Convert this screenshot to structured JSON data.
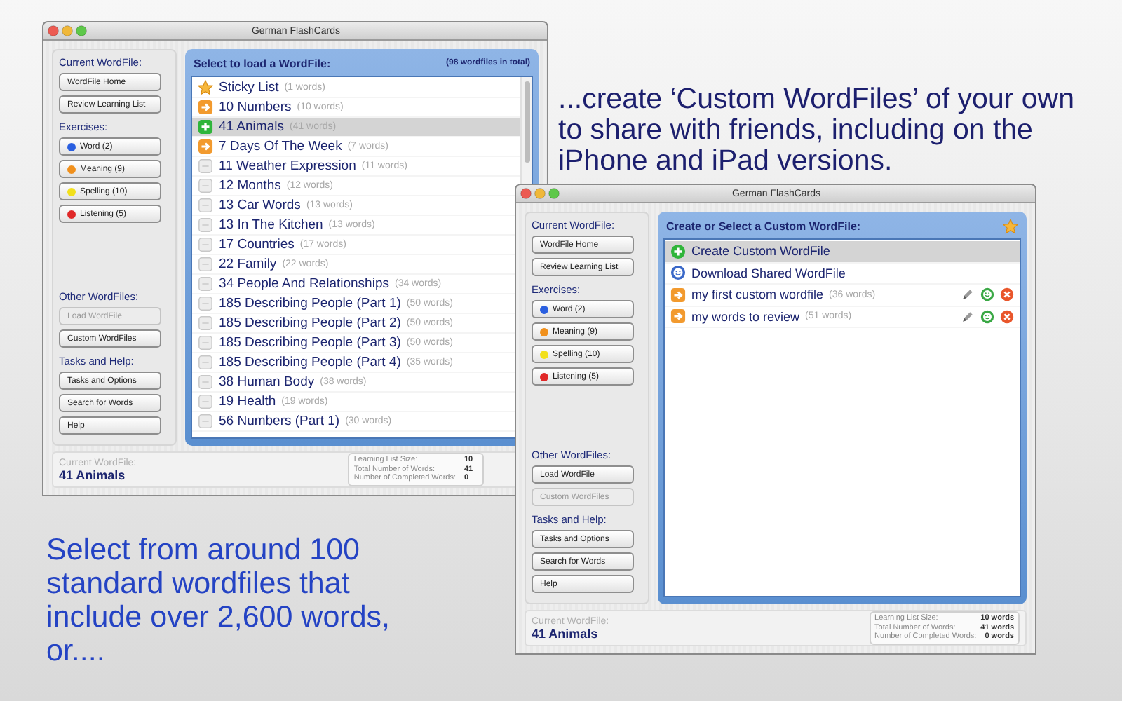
{
  "captions": [
    {
      "text": "...create ‘Custom WordFiles’ of your own to share with friends, including on the iPhone and iPad versions."
    },
    {
      "text": "Select from around 100 standard wordfiles that include over 2,600 words, or...."
    }
  ],
  "windows": [
    {
      "title": "German FlashCards",
      "sidebar": [
        {
          "heading": "Current WordFile:",
          "buttons": [
            {
              "label": "WordFile Home",
              "disabled": false
            },
            {
              "label": "Review Learning List",
              "disabled": false
            }
          ]
        },
        {
          "heading": "Exercises:",
          "buttons": [
            {
              "label": "Word (2)",
              "disabled": false,
              "color": "#2a5fe0"
            },
            {
              "label": "Meaning (9)",
              "disabled": false,
              "color": "#f0901c"
            },
            {
              "label": "Spelling (10)",
              "disabled": false,
              "color": "#f2e01c"
            },
            {
              "label": "Listening (5)",
              "disabled": false,
              "color": "#e02828"
            }
          ]
        },
        {
          "heading": "Other WordFiles:",
          "buttons": [
            {
              "label": "Load WordFile",
              "disabled": true
            },
            {
              "label": "Custom WordFiles",
              "disabled": false
            }
          ]
        },
        {
          "heading": "Tasks and Help:",
          "buttons": [
            {
              "label": "Tasks and Options",
              "disabled": false
            },
            {
              "label": "Search for Words",
              "disabled": false
            },
            {
              "label": "Help",
              "disabled": false
            }
          ]
        }
      ],
      "panel": {
        "title": "Select to load a WordFile:",
        "count": "(98 wordfiles in total)",
        "items": [
          {
            "kind": "star",
            "name": "Sticky List",
            "count": "(1 words)",
            "selected": false
          },
          {
            "kind": "arrow",
            "name": "10 Numbers",
            "count": "(10 words)",
            "selected": false
          },
          {
            "kind": "plus",
            "name": "41 Animals",
            "count": "(41 words)",
            "selected": true
          },
          {
            "kind": "arrow",
            "name": "7 Days Of The Week",
            "count": "(7 words)",
            "selected": false
          },
          {
            "kind": "blank",
            "name": "11 Weather Expression",
            "count": "(11 words)",
            "selected": false
          },
          {
            "kind": "blank",
            "name": "12 Months",
            "count": "(12 words)",
            "selected": false
          },
          {
            "kind": "blank",
            "name": "13 Car Words",
            "count": "(13 words)",
            "selected": false
          },
          {
            "kind": "blank",
            "name": "13 In The Kitchen",
            "count": "(13 words)",
            "selected": false
          },
          {
            "kind": "blank",
            "name": "17 Countries",
            "count": "(17 words)",
            "selected": false
          },
          {
            "kind": "blank",
            "name": "22 Family",
            "count": "(22 words)",
            "selected": false
          },
          {
            "kind": "blank",
            "name": "34 People And Relationships",
            "count": "(34 words)",
            "selected": false
          },
          {
            "kind": "blank",
            "name": "185 Describing People (Part 1)",
            "count": "(50 words)",
            "selected": false
          },
          {
            "kind": "blank",
            "name": "185 Describing People (Part 2)",
            "count": "(50 words)",
            "selected": false
          },
          {
            "kind": "blank",
            "name": "185 Describing People (Part 3)",
            "count": "(50 words)",
            "selected": false
          },
          {
            "kind": "blank",
            "name": "185 Describing People (Part 4)",
            "count": "(35 words)",
            "selected": false
          },
          {
            "kind": "blank",
            "name": "38 Human Body",
            "count": "(38 words)",
            "selected": false
          },
          {
            "kind": "blank",
            "name": "19 Health",
            "count": "(19 words)",
            "selected": false
          },
          {
            "kind": "blank",
            "name": "56 Numbers (Part 1)",
            "count": "(30 words)",
            "selected": false
          }
        ]
      },
      "footer": {
        "label": "Current WordFile:",
        "value": "41 Animals",
        "stats": [
          {
            "label": "Learning List Size:",
            "value": "10"
          },
          {
            "label": "Total Number of Words:",
            "value": "41"
          },
          {
            "label": "Number of Completed Words:",
            "value": "0"
          }
        ]
      }
    },
    {
      "title": "German FlashCards",
      "sidebar": [
        {
          "heading": "Current WordFile:",
          "buttons": [
            {
              "label": "WordFile Home",
              "disabled": false
            },
            {
              "label": "Review Learning List",
              "disabled": false
            }
          ]
        },
        {
          "heading": "Exercises:",
          "buttons": [
            {
              "label": "Word (2)",
              "disabled": false,
              "color": "#2a5fe0"
            },
            {
              "label": "Meaning (9)",
              "disabled": false,
              "color": "#f0901c"
            },
            {
              "label": "Spelling (10)",
              "disabled": false,
              "color": "#f2e01c"
            },
            {
              "label": "Listening (5)",
              "disabled": false,
              "color": "#e02828"
            }
          ]
        },
        {
          "heading": "Other WordFiles:",
          "buttons": [
            {
              "label": "Load WordFile",
              "disabled": false
            },
            {
              "label": "Custom WordFiles",
              "disabled": true
            }
          ]
        },
        {
          "heading": "Tasks and Help:",
          "buttons": [
            {
              "label": "Tasks and Options",
              "disabled": false
            },
            {
              "label": "Search for Words",
              "disabled": false
            },
            {
              "label": "Help",
              "disabled": false
            }
          ]
        }
      ],
      "panel": {
        "title": "Create or Select a Custom WordFile:",
        "star": true,
        "items": [
          {
            "kind": "create",
            "name": "Create Custom WordFile",
            "selected": true
          },
          {
            "kind": "download",
            "name": "Download Shared WordFile",
            "selected": false
          },
          {
            "kind": "custom",
            "name": "my first custom wordfile",
            "count": "(36 words)",
            "selected": false
          },
          {
            "kind": "custom",
            "name": "my words to review",
            "count": "(51 words)",
            "selected": false
          }
        ]
      },
      "footer": {
        "label": "Current WordFile:",
        "value": "41 Animals",
        "stats": [
          {
            "label": "Learning List Size:",
            "value": "10 words"
          },
          {
            "label": "Total Number of Words:",
            "value": "41 words"
          },
          {
            "label": "Number of Completed Words:",
            "value": "0 words"
          }
        ]
      }
    }
  ]
}
